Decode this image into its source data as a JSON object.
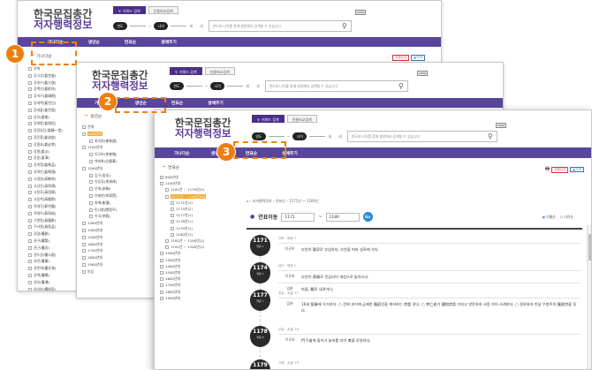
{
  "logo": {
    "line1": "한국문집총간",
    "line2": "저자행력정보"
  },
  "tabs": {
    "keyword": "키워드 검색",
    "catalog": "인물비교검색"
  },
  "search": {
    "from_label": "연도",
    "to_label": "나이",
    "suffix": "세",
    "wave": "~",
    "placeholder": "연도와 나이를 함께 설정해서 검색할 수 있습니다.",
    "kbd": "KRNB"
  },
  "nav": {
    "items": [
      "가나다순",
      "생년순",
      "연표순",
      "생애주기"
    ]
  },
  "buttons": {
    "alert": "오류신고",
    "top": "▲TOP"
  },
  "w1": {
    "section": "가나다순",
    "tree": [
      "전체",
      "강극성(姜克誠)",
      "강대수(姜大遂)",
      "강백년(姜栢年)",
      "강석기(姜碩期)",
      "강세백(姜世白)",
      "강세황(姜世晃)",
      "강유(姜維)",
      "강재항(姜再恒)",
      "강정일당(姜靜一堂)",
      "강준흠(姜浚欽)",
      "강필효(姜必孝)",
      "강항(姜沆)",
      "강혼(姜渾)",
      "강희맹(姜希孟)",
      "강희안(姜希顔)",
      "고경명(高敬命)",
      "고상안(高尙顔)",
      "고용후(高用厚)",
      "고응척(高應陟)",
      "곽세건(郭世楗)",
      "곽재우(郭再祐)",
      "구봉령(具鳳齡)",
      "구사맹(具思孟)",
      "권겹(權韐)",
      "권구(權榘)",
      "권근(權近)",
      "권두경(權斗經)",
      "권만(權萬)",
      "권문해(權文海)",
      "권벽(權擘)",
      "권부(權溥)",
      "권상하(權尙夏)"
    ]
  },
  "w2": {
    "section": "생년순",
    "tree": [
      "전체",
      "800년대",
      "최치원(崔致遠)",
      "1100년대",
      "이규보(李奎報)",
      "백비화(白賁華)",
      "1200년대",
      "김구(金坵)",
      "이승휴(李承休)",
      "안축(安軸)",
      "이제현(李齊賢)",
      "최해(崔瀣)",
      "민사평(閔思平)",
      "이곡(李穀)",
      "1300년대",
      "1400년대",
      "1500년대",
      "1600년대",
      "1700년대",
      "1800년대",
      "1900년대",
      "미상"
    ],
    "highlight": "800년대"
  },
  "w3": {
    "section": "연표순",
    "breadcrumb": "⌂ › 저자행력정보 › 연표순 › 1171년 ~ 1180년",
    "year_label": "연표이동",
    "year_from": "1171",
    "year_to": "1180",
    "go": "Go",
    "sort_a": "이름순",
    "sort_b": "나이순",
    "tree": [
      "800년대",
      "1100년대",
      "1161년 ~ 1170년(2)",
      "1171년 ~ 1180년(4)",
      "1181년 ~ 1190년(2)",
      "1191년 ~ 1200년(2)",
      "1200년대",
      "1300년대",
      "1400년대",
      "1500년대",
      "1600년대",
      "1700년대",
      "1800년대",
      "1900년대"
    ],
    "highlight": "1171년 ~ 1180년(4)",
    "sub_tree": [
      "1171년(1)",
      "1174년(2)",
      "1177년(1)",
      "1178년(1)",
      "1179년(1)",
      "1180년(1)"
    ],
    "entries": [
      {
        "year": "1171",
        "sub": "명종 1",
        "head": "신묘 · 희종 7",
        "rows": [
          {
            "k": "이규보",
            "v": "부친의 賦료로 부임하자, 부친을 따라 성화에 가다."
          }
        ]
      },
      {
        "year": "1174",
        "sub": "명종 4",
        "head": "갑오 · 명종 1",
        "rows": [
          {
            "k": "이규보",
            "v": "부친이 燕條로 전임되어 개성으로 돌아오다."
          },
          {
            "k": "임춘",
            "v": "마을, 鵝로 내려가다."
          }
        ]
      },
      {
        "year": "1177",
        "sub": "명종 7",
        "head": "정유 · 大定 17",
        "rows": [
          {
            "k": "임춘",
            "v": "10세 變事에 우거하다. ○ 전에 과거에 급제한 龍庭인을 축하하는 詩를 짓다. ○ 李仁老가 鍾和詩를 가지고 방문하자 사용 지어 사례하다. ○ 정료와의 만남 수봉주의 龍晉詩을 짓다."
          }
        ]
      },
      {
        "year": "1178",
        "sub": "명종 8",
        "head": "무술 · 大定 18",
        "rows": [
          {
            "k": "이규보",
            "v": "門下省에 들어가 놀비를 지어 衆을 모일하다."
          }
        ]
      },
      {
        "year": "1179",
        "sub": "명종 9",
        "head": "기해 · 大定 19",
        "rows": []
      }
    ]
  },
  "steps": [
    "1",
    "2",
    "3"
  ]
}
